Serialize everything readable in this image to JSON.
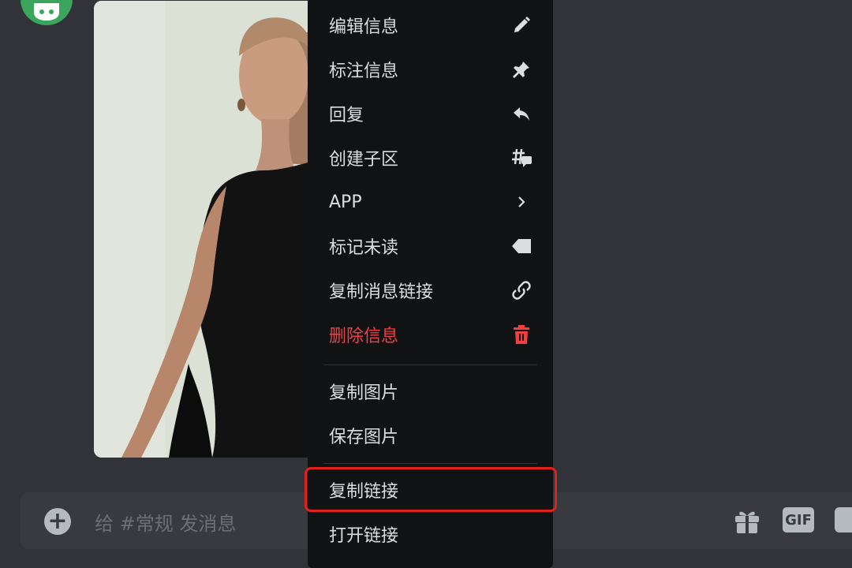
{
  "menu": {
    "items": [
      {
        "label": "编辑信息",
        "icon": "pencil-icon"
      },
      {
        "label": "标注信息",
        "icon": "pin-icon"
      },
      {
        "label": "回复",
        "icon": "reply-icon"
      },
      {
        "label": "创建子区",
        "icon": "thread-icon"
      },
      {
        "label": "APP",
        "icon": "chevron-right-icon"
      },
      {
        "label": "标记未读",
        "icon": "mark-unread-icon"
      },
      {
        "label": "复制消息链接",
        "icon": "link-icon"
      },
      {
        "label": "删除信息",
        "icon": "trash-icon"
      },
      {
        "label": "复制图片"
      },
      {
        "label": "保存图片"
      },
      {
        "label": "复制链接"
      },
      {
        "label": "打开链接"
      }
    ],
    "danger_color": "#f23f43",
    "highlight_color": "#e0201e"
  },
  "composer": {
    "placeholder": "给 #常规 发消息",
    "gif_label": "GIF"
  }
}
